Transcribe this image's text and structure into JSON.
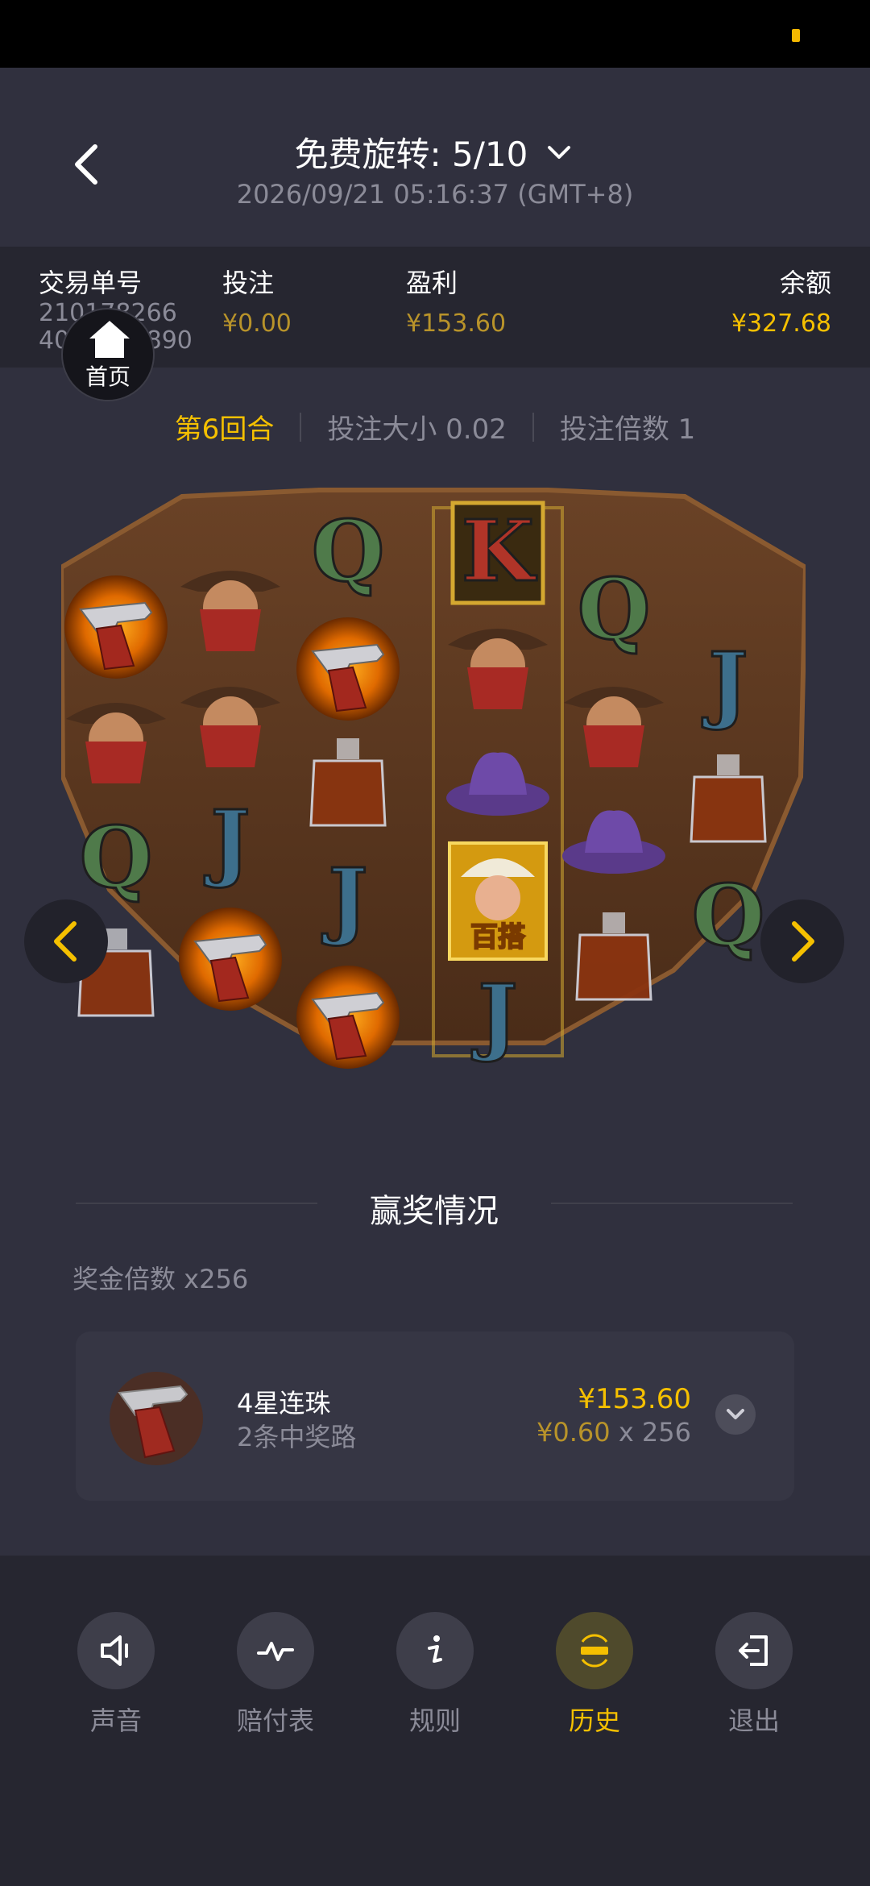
{
  "header": {
    "title": "免费旋转: 5/10",
    "datetime": "2026/09/21 05:16:37 (GMT+8)"
  },
  "info": {
    "order_label": "交易单号",
    "order_line1": "210178266",
    "order_line2": "4064547890",
    "bet_label": "投注",
    "bet_value": "¥0.00",
    "profit_label": "盈利",
    "profit_value": "¥153.60",
    "balance_label": "余额",
    "balance_value": "¥327.68"
  },
  "home": {
    "label": "首页"
  },
  "round": {
    "round_label": "第6回合",
    "bet_size": "投注大小 0.02",
    "bet_multiplier": "投注倍数 1"
  },
  "board": {
    "wild_text": "百搭",
    "reels": [
      [
        "revolver",
        "bandit",
        "Q",
        "whiskey"
      ],
      [
        "bandit",
        "bandit",
        "J",
        "revolver"
      ],
      [
        "Q",
        "revolver",
        "whiskey",
        "J",
        "revolver"
      ],
      [
        "K",
        "bandit",
        "purple-hat",
        "wild-sheriff",
        "J"
      ],
      [
        "Q",
        "bandit",
        "purple-hat",
        "whiskey"
      ],
      [
        "J",
        "whiskey",
        "Q"
      ]
    ]
  },
  "win": {
    "section_title": "赢奖情况",
    "multiplier_label": "奖金倍数 x256",
    "symbol_icon": "revolver-icon",
    "name": "4星连珠",
    "ways": "2条中奖路",
    "amount": "¥153.60",
    "unit_value": "¥0.60",
    "times": " x 256"
  },
  "tabs": [
    {
      "label": "声音",
      "icon": "speaker-icon"
    },
    {
      "label": "赔付表",
      "icon": "paytable-icon"
    },
    {
      "label": "规则",
      "icon": "info-icon"
    },
    {
      "label": "历史",
      "icon": "history-icon",
      "active": true
    },
    {
      "label": "退出",
      "icon": "exit-icon"
    }
  ],
  "colors": {
    "accent": "#f5c000",
    "background": "#30303e",
    "panel": "#262630"
  }
}
